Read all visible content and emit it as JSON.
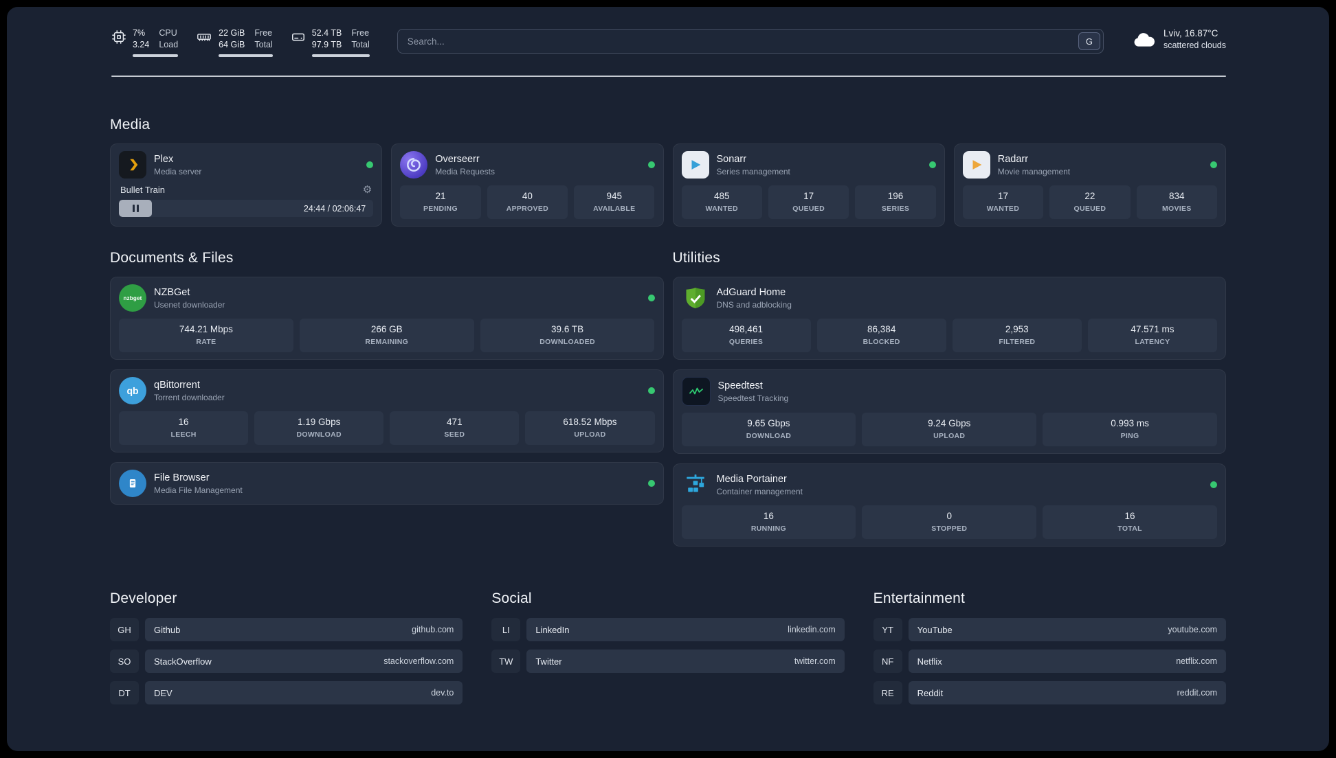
{
  "topbar": {
    "cpu": {
      "value_top": "7%",
      "value_bottom": "3.24",
      "label_top": "CPU",
      "label_bottom": "Load"
    },
    "ram": {
      "value_top": "22 GiB",
      "value_bottom": "64 GiB",
      "label_top": "Free",
      "label_bottom": "Total"
    },
    "disk": {
      "value_top": "52.4 TB",
      "value_bottom": "97.9 TB",
      "label_top": "Free",
      "label_bottom": "Total"
    },
    "search": {
      "placeholder": "Search...",
      "shortcut": "G"
    },
    "weather": {
      "location": "Lviv, 16.87°C",
      "condition": "scattered clouds"
    }
  },
  "section_titles": {
    "media": "Media",
    "documents": "Documents & Files",
    "utilities": "Utilities",
    "developer": "Developer",
    "social": "Social",
    "entertainment": "Entertainment"
  },
  "apps": {
    "plex": {
      "name": "Plex",
      "subtitle": "Media server",
      "now_playing": "Bullet Train",
      "time": "24:44 / 02:06:47",
      "progress_percent": 13
    },
    "overseerr": {
      "name": "Overseerr",
      "subtitle": "Media Requests",
      "stats": [
        {
          "value": "21",
          "label": "PENDING"
        },
        {
          "value": "40",
          "label": "APPROVED"
        },
        {
          "value": "945",
          "label": "AVAILABLE"
        }
      ]
    },
    "sonarr": {
      "name": "Sonarr",
      "subtitle": "Series management",
      "stats": [
        {
          "value": "485",
          "label": "WANTED"
        },
        {
          "value": "17",
          "label": "QUEUED"
        },
        {
          "value": "196",
          "label": "SERIES"
        }
      ]
    },
    "radarr": {
      "name": "Radarr",
      "subtitle": "Movie management",
      "stats": [
        {
          "value": "17",
          "label": "WANTED"
        },
        {
          "value": "22",
          "label": "QUEUED"
        },
        {
          "value": "834",
          "label": "MOVIES"
        }
      ]
    },
    "nzbget": {
      "name": "NZBGet",
      "subtitle": "Usenet downloader",
      "stats": [
        {
          "value": "744.21 Mbps",
          "label": "RATE"
        },
        {
          "value": "266 GB",
          "label": "REMAINING"
        },
        {
          "value": "39.6 TB",
          "label": "DOWNLOADED"
        }
      ]
    },
    "adguard": {
      "name": "AdGuard Home",
      "subtitle": "DNS and adblocking",
      "stats": [
        {
          "value": "498,461",
          "label": "QUERIES"
        },
        {
          "value": "86,384",
          "label": "BLOCKED"
        },
        {
          "value": "2,953",
          "label": "FILTERED"
        },
        {
          "value": "47.571 ms",
          "label": "LATENCY"
        }
      ]
    },
    "qbittorrent": {
      "name": "qBittorrent",
      "subtitle": "Torrent downloader",
      "stats": [
        {
          "value": "16",
          "label": "LEECH"
        },
        {
          "value": "1.19 Gbps",
          "label": "DOWNLOAD"
        },
        {
          "value": "471",
          "label": "SEED"
        },
        {
          "value": "618.52 Mbps",
          "label": "UPLOAD"
        }
      ]
    },
    "speedtest": {
      "name": "Speedtest",
      "subtitle": "Speedtest Tracking",
      "stats": [
        {
          "value": "9.65 Gbps",
          "label": "DOWNLOAD"
        },
        {
          "value": "9.24 Gbps",
          "label": "UPLOAD"
        },
        {
          "value": "0.993 ms",
          "label": "PING"
        }
      ]
    },
    "filebrowser": {
      "name": "File Browser",
      "subtitle": "Media File Management"
    },
    "portainer": {
      "name": "Media Portainer",
      "subtitle": "Container management",
      "stats": [
        {
          "value": "16",
          "label": "RUNNING"
        },
        {
          "value": "0",
          "label": "STOPPED"
        },
        {
          "value": "16",
          "label": "TOTAL"
        }
      ]
    }
  },
  "links": {
    "developer": [
      {
        "abbr": "GH",
        "name": "Github",
        "url": "github.com"
      },
      {
        "abbr": "SO",
        "name": "StackOverflow",
        "url": "stackoverflow.com"
      },
      {
        "abbr": "DT",
        "name": "DEV",
        "url": "dev.to"
      }
    ],
    "social": [
      {
        "abbr": "LI",
        "name": "LinkedIn",
        "url": "linkedin.com"
      },
      {
        "abbr": "TW",
        "name": "Twitter",
        "url": "twitter.com"
      }
    ],
    "entertainment": [
      {
        "abbr": "YT",
        "name": "YouTube",
        "url": "youtube.com"
      },
      {
        "abbr": "NF",
        "name": "Netflix",
        "url": "netflix.com"
      },
      {
        "abbr": "RE",
        "name": "Reddit",
        "url": "reddit.com"
      }
    ]
  },
  "colors": {
    "status_online": "#37c871",
    "plex_accent": "#e5a00d",
    "sonarr_accent": "#35a0d8",
    "radarr_accent": "#eda73b",
    "adguard_accent": "#5fae2e",
    "speedtest_accent": "#2ecc71",
    "portainer_accent": "#2da7dd"
  }
}
